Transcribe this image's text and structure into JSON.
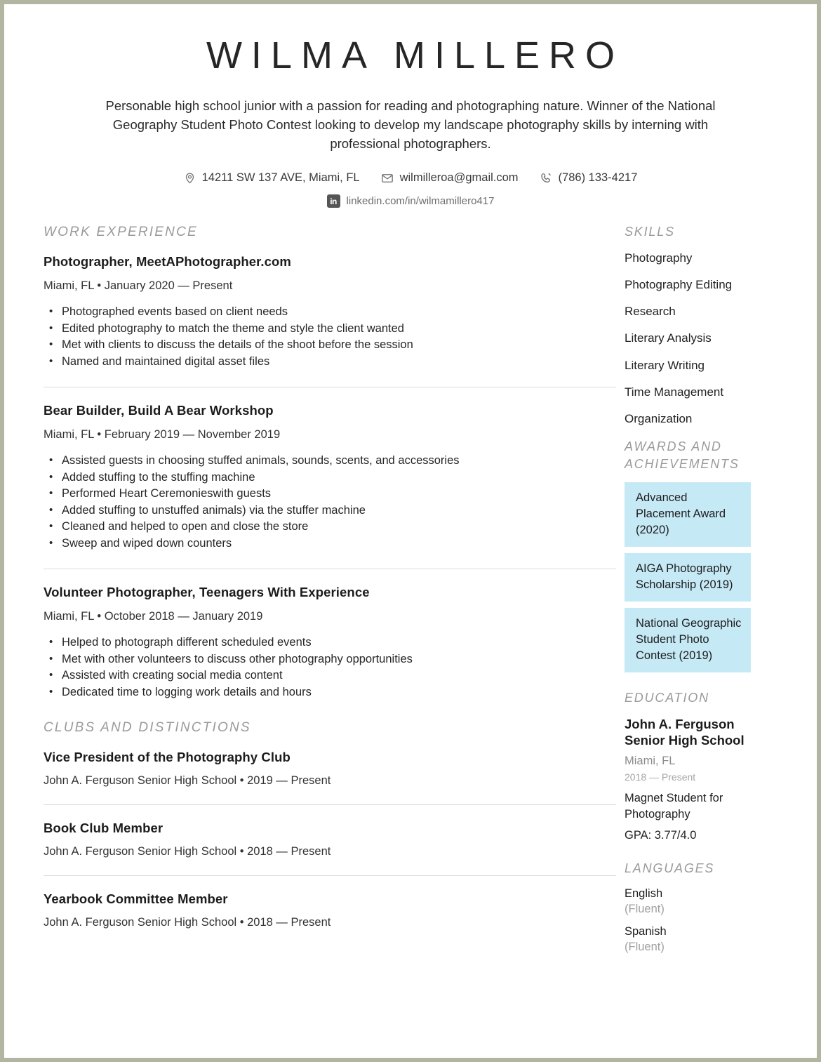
{
  "header": {
    "name": "WILMA MILLERO",
    "summary": "Personable high school junior with a passion for reading and photographing nature. Winner of the National Geography Student Photo Contest looking to develop my landscape photography skills by interning with professional photographers.",
    "contact": {
      "address": "14211 SW 137 AVE, Miami, FL",
      "email": "wilmilleroa@gmail.com",
      "phone": "(786) 133-4217",
      "linkedin": "linkedin.com/in/wilmamillero417",
      "linkedin_badge": "in",
      "icons": {
        "address": "location-pin-icon",
        "email": "envelope-icon",
        "phone": "phone-icon",
        "linkedin": "linkedin-icon"
      }
    }
  },
  "main": {
    "work_experience": {
      "heading": "WORK EXPERIENCE",
      "entries": [
        {
          "title": "Photographer, MeetAPhotographer.com",
          "meta": "Miami, FL • January 2020 — Present",
          "bullets": [
            "Photographed events based on client needs",
            "Edited photography to match the theme and style the client wanted",
            "Met with clients to discuss the details of the shoot before the session",
            "Named and maintained digital asset files"
          ]
        },
        {
          "title": "Bear Builder, Build A Bear Workshop",
          "meta": "Miami, FL • February 2019 — November 2019",
          "bullets": [
            "Assisted guests in choosing stuffed animals, sounds, scents, and accessories",
            "Added stuffing to the stuffing machine",
            "Performed Heart Ceremonieswith guests",
            "Added stuffing to unstuffed animals) via the stuffer machine",
            "Cleaned and helped to open and close the store",
            "Sweep and wiped down counters"
          ]
        },
        {
          "title": "Volunteer Photographer, Teenagers With Experience",
          "meta": "Miami, FL • October 2018 — January 2019",
          "bullets": [
            "Helped to photograph different scheduled events",
            "Met with other volunteers to discuss other photography opportunities",
            "Assisted with creating social media content",
            "Dedicated time to logging work details and hours"
          ]
        }
      ]
    },
    "clubs": {
      "heading": "CLUBS AND DISTINCTIONS",
      "entries": [
        {
          "title": "Vice President of the Photography Club",
          "meta": "John A. Ferguson Senior High School • 2019 — Present"
        },
        {
          "title": "Book Club Member",
          "meta": "John A. Ferguson Senior High School • 2018 — Present"
        },
        {
          "title": "Yearbook Committee Member",
          "meta": "John A. Ferguson Senior High School • 2018 — Present"
        }
      ]
    }
  },
  "sidebar": {
    "skills": {
      "heading": "SKILLS",
      "items": [
        "Photography",
        "Photography Editing",
        "Research",
        "Literary Analysis",
        "Literary Writing",
        "Time Management",
        "Organization"
      ]
    },
    "awards": {
      "heading": "AWARDS AND ACHIEVEMENTS",
      "box_color": "#c6e9f6",
      "items": [
        "Advanced Placement Award (2020)",
        "AIGA Photography Scholarship (2019)",
        "National Geographic Student Photo Contest (2019)"
      ]
    },
    "education": {
      "heading": "EDUCATION",
      "school": "John A. Ferguson Senior High School",
      "location": "Miami, FL",
      "dates": "2018 — Present",
      "note": "Magnet Student for Photography",
      "gpa": "GPA: 3.77/4.0"
    },
    "languages": {
      "heading": "LANGUAGES",
      "items": [
        {
          "name": "English",
          "level": "(Fluent)"
        },
        {
          "name": "Spanish",
          "level": "(Fluent)"
        }
      ]
    }
  }
}
